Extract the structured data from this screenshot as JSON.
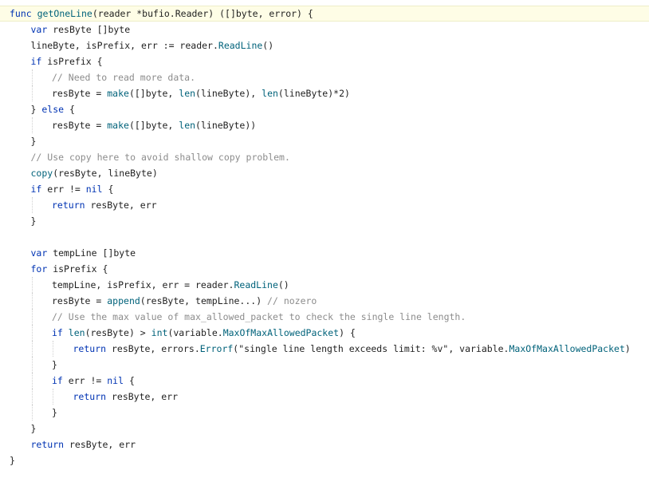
{
  "editor": {
    "colors": {
      "plain": "#1f1f1f",
      "keyword": "#0033b3",
      "function": "#00627a",
      "comment": "#8c8c8c",
      "current_line": "#fefde6"
    },
    "lines": [
      {
        "indent": 0,
        "current": true,
        "tokens": [
          {
            "t": "func ",
            "k": "keyword"
          },
          {
            "t": "getOneLine",
            "k": "function"
          },
          {
            "t": "(reader *bufio.Reader) ([]byte, error) {",
            "k": "plain"
          }
        ]
      },
      {
        "indent": 1,
        "tokens": [
          {
            "t": "var ",
            "k": "keyword"
          },
          {
            "t": "resByte []byte",
            "k": "plain"
          }
        ]
      },
      {
        "indent": 1,
        "tokens": [
          {
            "t": "lineByte, isPrefix, err := reader.",
            "k": "plain"
          },
          {
            "t": "ReadLine",
            "k": "function"
          },
          {
            "t": "()",
            "k": "plain"
          }
        ]
      },
      {
        "indent": 1,
        "tokens": [
          {
            "t": "if ",
            "k": "keyword"
          },
          {
            "t": "isPrefix {",
            "k": "plain"
          }
        ]
      },
      {
        "indent": 2,
        "tokens": [
          {
            "t": "// Need to read more data.",
            "k": "comment"
          }
        ]
      },
      {
        "indent": 2,
        "tokens": [
          {
            "t": "resByte = ",
            "k": "plain"
          },
          {
            "t": "make",
            "k": "function"
          },
          {
            "t": "([]byte, ",
            "k": "plain"
          },
          {
            "t": "len",
            "k": "function"
          },
          {
            "t": "(lineByte), ",
            "k": "plain"
          },
          {
            "t": "len",
            "k": "function"
          },
          {
            "t": "(lineByte)*2)",
            "k": "plain"
          }
        ]
      },
      {
        "indent": 1,
        "tokens": [
          {
            "t": "} ",
            "k": "plain"
          },
          {
            "t": "else",
            "k": "keyword"
          },
          {
            "t": " {",
            "k": "plain"
          }
        ]
      },
      {
        "indent": 2,
        "tokens": [
          {
            "t": "resByte = ",
            "k": "plain"
          },
          {
            "t": "make",
            "k": "function"
          },
          {
            "t": "([]byte, ",
            "k": "plain"
          },
          {
            "t": "len",
            "k": "function"
          },
          {
            "t": "(lineByte))",
            "k": "plain"
          }
        ]
      },
      {
        "indent": 1,
        "tokens": [
          {
            "t": "}",
            "k": "plain"
          }
        ]
      },
      {
        "indent": 1,
        "tokens": [
          {
            "t": "// Use copy here to avoid shallow copy problem.",
            "k": "comment"
          }
        ]
      },
      {
        "indent": 1,
        "tokens": [
          {
            "t": "copy",
            "k": "function"
          },
          {
            "t": "(resByte, lineByte)",
            "k": "plain"
          }
        ]
      },
      {
        "indent": 1,
        "tokens": [
          {
            "t": "if ",
            "k": "keyword"
          },
          {
            "t": "err != ",
            "k": "plain"
          },
          {
            "t": "nil",
            "k": "keyword"
          },
          {
            "t": " {",
            "k": "plain"
          }
        ]
      },
      {
        "indent": 2,
        "tokens": [
          {
            "t": "return ",
            "k": "keyword"
          },
          {
            "t": "resByte, err",
            "k": "plain"
          }
        ]
      },
      {
        "indent": 1,
        "tokens": [
          {
            "t": "}",
            "k": "plain"
          }
        ]
      },
      {
        "indent": 0,
        "blank": true,
        "tokens": []
      },
      {
        "indent": 1,
        "tokens": [
          {
            "t": "var ",
            "k": "keyword"
          },
          {
            "t": "tempLine []byte",
            "k": "plain"
          }
        ]
      },
      {
        "indent": 1,
        "tokens": [
          {
            "t": "for ",
            "k": "keyword"
          },
          {
            "t": "isPrefix {",
            "k": "plain"
          }
        ]
      },
      {
        "indent": 2,
        "tokens": [
          {
            "t": "tempLine, isPrefix, err = reader.",
            "k": "plain"
          },
          {
            "t": "ReadLine",
            "k": "function"
          },
          {
            "t": "()",
            "k": "plain"
          }
        ]
      },
      {
        "indent": 2,
        "tokens": [
          {
            "t": "resByte = ",
            "k": "plain"
          },
          {
            "t": "append",
            "k": "function"
          },
          {
            "t": "(resByte, tempLine...) ",
            "k": "plain"
          },
          {
            "t": "// nozero",
            "k": "comment"
          }
        ]
      },
      {
        "indent": 2,
        "tokens": [
          {
            "t": "// Use the max value of max_allowed_packet to check the single line length.",
            "k": "comment"
          }
        ]
      },
      {
        "indent": 2,
        "tokens": [
          {
            "t": "if ",
            "k": "keyword"
          },
          {
            "t": "len",
            "k": "function"
          },
          {
            "t": "(resByte) > ",
            "k": "plain"
          },
          {
            "t": "int",
            "k": "function"
          },
          {
            "t": "(variable.",
            "k": "plain"
          },
          {
            "t": "MaxOfMaxAllowedPacket",
            "k": "function"
          },
          {
            "t": ") {",
            "k": "plain"
          }
        ]
      },
      {
        "indent": 3,
        "tokens": [
          {
            "t": "return ",
            "k": "keyword"
          },
          {
            "t": "resByte, errors.",
            "k": "plain"
          },
          {
            "t": "Errorf",
            "k": "function"
          },
          {
            "t": "(\"single line length exceeds limit: %v\", variable.",
            "k": "plain"
          },
          {
            "t": "MaxOfMaxAllowedPacket",
            "k": "function"
          },
          {
            "t": ")",
            "k": "plain"
          }
        ]
      },
      {
        "indent": 2,
        "tokens": [
          {
            "t": "}",
            "k": "plain"
          }
        ]
      },
      {
        "indent": 2,
        "tokens": [
          {
            "t": "if ",
            "k": "keyword"
          },
          {
            "t": "err != ",
            "k": "plain"
          },
          {
            "t": "nil",
            "k": "keyword"
          },
          {
            "t": " {",
            "k": "plain"
          }
        ]
      },
      {
        "indent": 3,
        "tokens": [
          {
            "t": "return ",
            "k": "keyword"
          },
          {
            "t": "resByte, err",
            "k": "plain"
          }
        ]
      },
      {
        "indent": 2,
        "tokens": [
          {
            "t": "}",
            "k": "plain"
          }
        ]
      },
      {
        "indent": 1,
        "tokens": [
          {
            "t": "}",
            "k": "plain"
          }
        ]
      },
      {
        "indent": 1,
        "tokens": [
          {
            "t": "return ",
            "k": "keyword"
          },
          {
            "t": "resByte, err",
            "k": "plain"
          }
        ]
      },
      {
        "indent": 0,
        "tokens": [
          {
            "t": "}",
            "k": "plain"
          }
        ]
      }
    ]
  }
}
